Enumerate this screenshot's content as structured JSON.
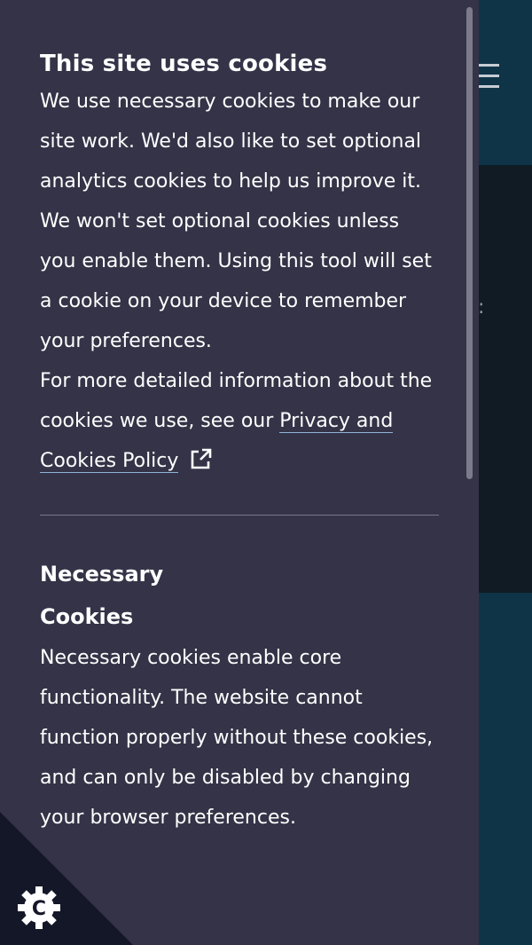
{
  "panel": {
    "title": "This site uses cookies",
    "intro": "We use necessary cookies to make our site work. We'd also like to set optional analytics cookies to help us improve it. We won't set optional cookies unless you enable them. Using this tool will set a cookie on your device to remember your preferences.",
    "more_info_prefix": "For more detailed information about the cookies we use, see our ",
    "policy_link_label": "Privacy and Cookies Policy",
    "policy_link_icon": "external-link-icon"
  },
  "necessary": {
    "title": "Necessary Cookies",
    "description": "Necessary cookies enable core functionality. The website cannot function properly without these cookies, and can only be disabled by changing your browser preferences."
  },
  "background": {
    "menu_icon": "hamburger-menu-icon",
    "partial_char": ":"
  },
  "badge": {
    "icon": "cookie-settings-icon",
    "letter": "C"
  },
  "colors": {
    "panel_bg": "#343347",
    "site_bg": "#0f3447",
    "site_dark": "#101b24",
    "text": "#ffffff",
    "link_underline": "#8fb3d9"
  }
}
